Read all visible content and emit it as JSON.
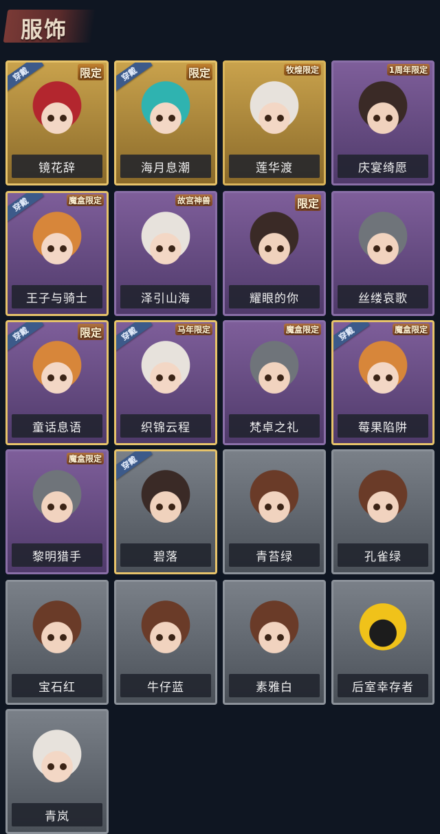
{
  "header": {
    "title": "服饰"
  },
  "equipped_label": "穿戴",
  "items": [
    {
      "name": "镜花辞",
      "rarity": "gold",
      "badge": "限定",
      "equipped": true,
      "hair": "hair-red"
    },
    {
      "name": "海月息潮",
      "rarity": "gold",
      "badge": "限定",
      "equipped": true,
      "hair": "hair-cyan"
    },
    {
      "name": "莲华渡",
      "rarity": "gold",
      "badge": "牧煌限定",
      "equipped": false,
      "hair": "hair-white"
    },
    {
      "name": "庆宴绮愿",
      "rarity": "purple",
      "badge": "1周年限定",
      "equipped": false,
      "hair": "hair-dark"
    },
    {
      "name": "王子与骑士",
      "rarity": "purple",
      "badge": "魔盒限定",
      "equipped": true,
      "hair": "hair-ginger"
    },
    {
      "name": "泽引山海",
      "rarity": "purple",
      "badge": "故宫神兽",
      "equipped": false,
      "hair": "hair-white"
    },
    {
      "name": "耀眼的你",
      "rarity": "purple",
      "badge": "限定",
      "equipped": false,
      "hair": "hair-dark"
    },
    {
      "name": "丝缕哀歌",
      "rarity": "purple",
      "badge": "",
      "equipped": false,
      "hair": "hair-gray"
    },
    {
      "name": "童话息语",
      "rarity": "purple",
      "badge": "限定",
      "equipped": true,
      "hair": "hair-ginger"
    },
    {
      "name": "织锦云程",
      "rarity": "purple",
      "badge": "马年限定",
      "equipped": true,
      "hair": "hair-white"
    },
    {
      "name": "梵卓之礼",
      "rarity": "purple",
      "badge": "魔盒限定",
      "equipped": false,
      "hair": "hair-gray"
    },
    {
      "name": "莓果陷阱",
      "rarity": "purple",
      "badge": "魔盒限定",
      "equipped": true,
      "hair": "hair-ginger"
    },
    {
      "name": "黎明猎手",
      "rarity": "purple",
      "badge": "魔盒限定",
      "equipped": false,
      "hair": "hair-gray"
    },
    {
      "name": "碧落",
      "rarity": "gray",
      "badge": "",
      "equipped": true,
      "hair": "hair-dark"
    },
    {
      "name": "青苔绿",
      "rarity": "gray",
      "badge": "",
      "equipped": false,
      "hair": "hair-brown"
    },
    {
      "name": "孔雀绿",
      "rarity": "gray",
      "badge": "",
      "equipped": false,
      "hair": "hair-brown"
    },
    {
      "name": "宝石红",
      "rarity": "gray",
      "badge": "",
      "equipped": false,
      "hair": "hair-brown"
    },
    {
      "name": "牛仔蓝",
      "rarity": "gray",
      "badge": "",
      "equipped": false,
      "hair": "hair-brown"
    },
    {
      "name": "素雅白",
      "rarity": "gray",
      "badge": "",
      "equipped": false,
      "hair": "hair-brown"
    },
    {
      "name": "后室幸存者",
      "rarity": "gray",
      "badge": "",
      "equipped": false,
      "hair": "hazmat"
    },
    {
      "name": "青岚",
      "rarity": "gray",
      "badge": "",
      "equipped": false,
      "hair": "hair-white"
    }
  ]
}
